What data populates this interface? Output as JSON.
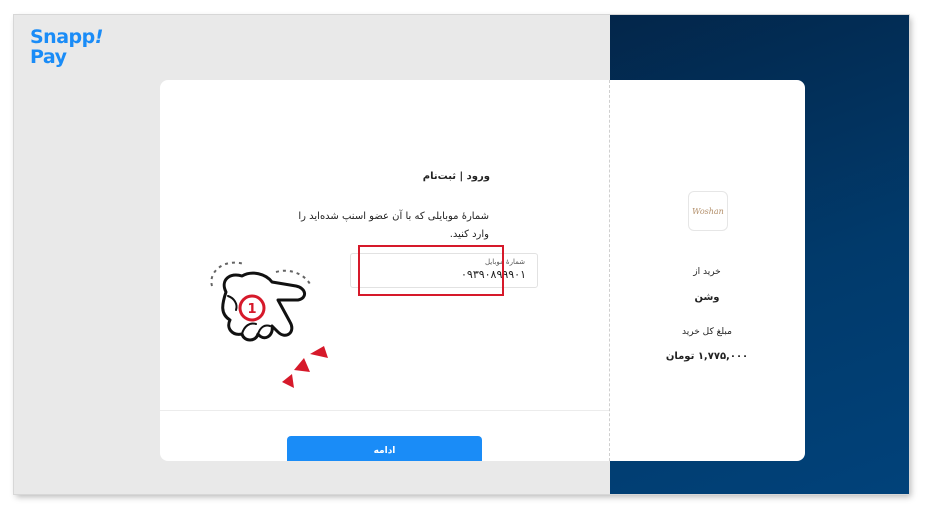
{
  "brand": {
    "logo_line1": "Snapp",
    "logo_mark": "!",
    "logo_line2": "Pay"
  },
  "login": {
    "title": "ورود | ثبت‌نام",
    "instruction": "شمارهٔ موبایلی که با آن عضو اسنپ شده‌اید را وارد کنید.",
    "mobile_label": "شمارهٔ موبایل",
    "mobile_value": "۰۹۳۹۰۸۹۹۹۰۱",
    "continue_label": "ادامه"
  },
  "order": {
    "merchant_logo_text": "Woshan",
    "buy_from_label": "خرید از",
    "merchant_name": "وشن",
    "total_label": "مبلغ کل خرید",
    "total_value": "۱,۷۷۵,۰۰۰ تومان"
  },
  "annotation": {
    "step_number": "1"
  },
  "colors": {
    "accent": "#1a8cf7",
    "highlight": "#d6192a",
    "right_panel": "#023665",
    "left_bg": "#e9e9e9"
  }
}
